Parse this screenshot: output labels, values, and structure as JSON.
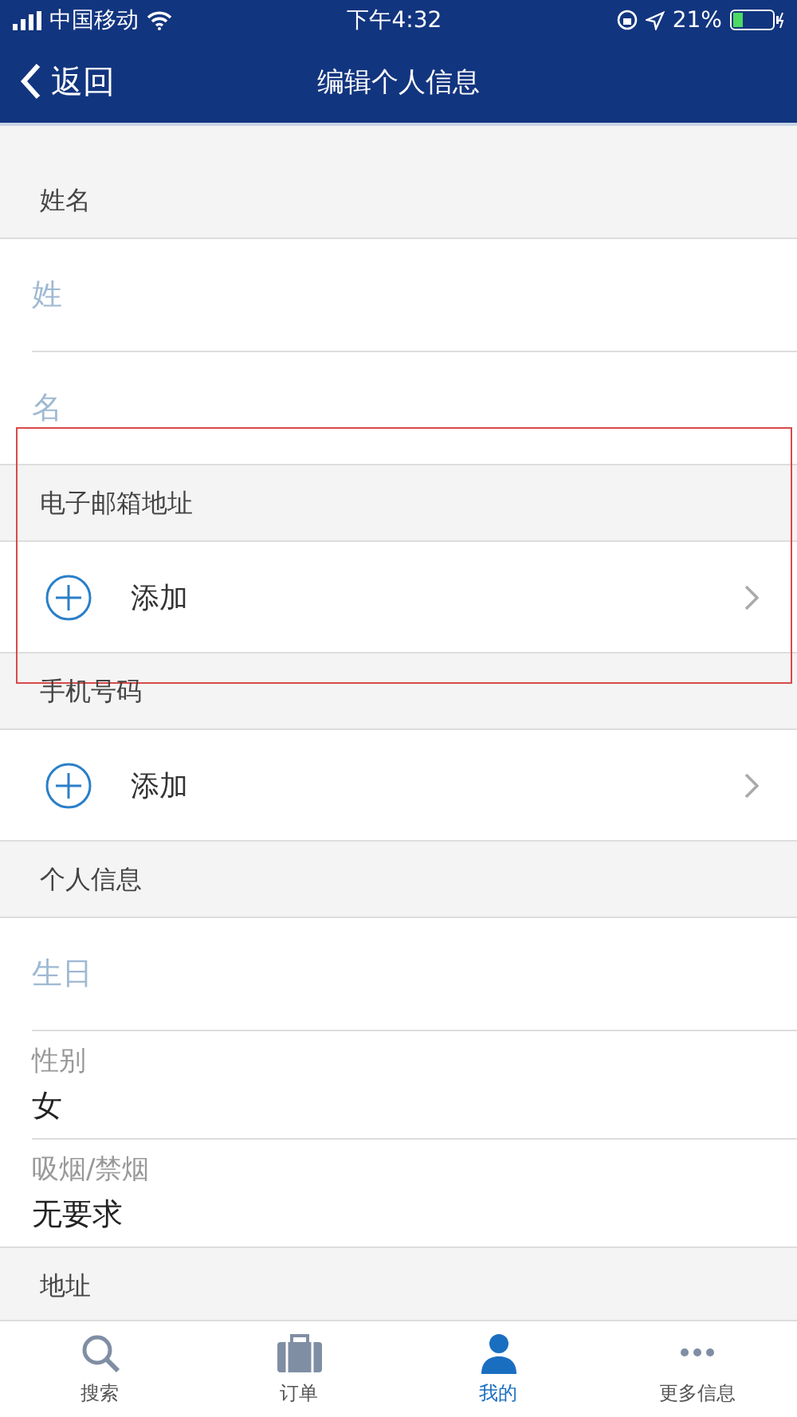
{
  "status_bar": {
    "carrier": "中国移动",
    "time": "下午4:32",
    "battery_percent": "21%"
  },
  "nav": {
    "back": "返回",
    "title": "编辑个人信息"
  },
  "sections": [
    {
      "title": "姓名",
      "highlighted": false,
      "rows": [
        {
          "kind": "input",
          "placeholder": "姓"
        },
        {
          "kind": "input",
          "placeholder": "名"
        }
      ]
    },
    {
      "title": "电子邮箱地址",
      "highlighted": true,
      "rows": [
        {
          "kind": "add",
          "label": "添加"
        }
      ]
    },
    {
      "title": "手机号码",
      "highlighted": false,
      "rows": [
        {
          "kind": "add",
          "label": "添加"
        }
      ]
    },
    {
      "title": "个人信息",
      "highlighted": false,
      "rows": [
        {
          "kind": "input",
          "placeholder": "生日"
        },
        {
          "kind": "value",
          "label": "性别",
          "value": "女"
        },
        {
          "kind": "value",
          "label": "吸烟/禁烟",
          "value": "无要求"
        }
      ]
    },
    {
      "title": "地址",
      "highlighted": false
    }
  ],
  "tabs": [
    {
      "label": "搜索",
      "kind": "search",
      "selected": false
    },
    {
      "label": "订单",
      "kind": "orders",
      "selected": false
    },
    {
      "label": "我的",
      "kind": "profile",
      "selected": true
    },
    {
      "label": "更多信息",
      "kind": "more",
      "selected": false
    }
  ]
}
